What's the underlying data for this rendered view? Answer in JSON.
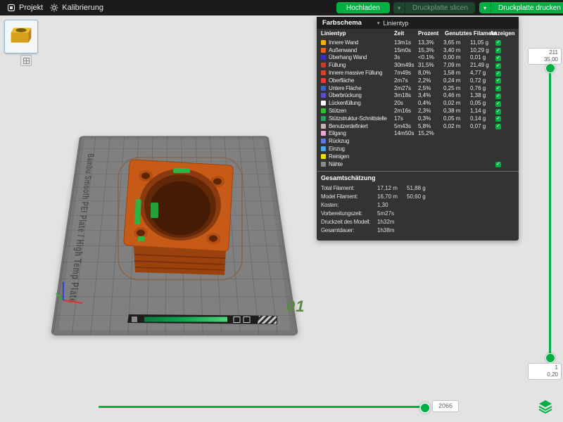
{
  "colors": {
    "accent": "#00AE42"
  },
  "topbar": {
    "project": "Projekt",
    "calibration": "Kalibrierung",
    "upload": "Hochladen",
    "slice": "Druckplatte slicen",
    "print": "Druckplatte drucken"
  },
  "viewport": {
    "plate_text": "Bambu Smooth PEI Plate / High Temp Plate",
    "plate_number": "01"
  },
  "panel": {
    "title": "Farbschema",
    "mode": "Linientyp",
    "columns": [
      "Linientyp",
      "Zeit",
      "Prozent",
      "Genutztes Filament",
      "Anzeigen"
    ],
    "rows": [
      {
        "name": "Innere Wand",
        "color": "#f8b500",
        "time": "13m1s",
        "percent": "13,3%",
        "filament_m": "3,65 m",
        "filament_g": "11,05 g",
        "checked": true
      },
      {
        "name": "Außenwand",
        "color": "#e8611c",
        "time": "15m0s",
        "percent": "15,3%",
        "filament_m": "3,40 m",
        "filament_g": "10,29 g",
        "checked": true
      },
      {
        "name": "Überhang Wand",
        "color": "#3a2cc8",
        "time": "3s",
        "percent": "<0.1%",
        "filament_m": "0,00 m",
        "filament_g": "0,01 g",
        "checked": true
      },
      {
        "name": "Füllung",
        "color": "#c23e28",
        "time": "30m49s",
        "percent": "31,5%",
        "filament_m": "7,09 m",
        "filament_g": "21,49 g",
        "checked": true
      },
      {
        "name": "Innere massive Füllung",
        "color": "#d8442a",
        "time": "7m49s",
        "percent": "8,0%",
        "filament_m": "1,58 m",
        "filament_g": "4,77 g",
        "checked": true
      },
      {
        "name": "Oberfläche",
        "color": "#ee3a3a",
        "time": "2m7s",
        "percent": "2,2%",
        "filament_m": "0,24 m",
        "filament_g": "0,72 g",
        "checked": true
      },
      {
        "name": "Untere Fläche",
        "color": "#3864c8",
        "time": "2m27s",
        "percent": "2,5%",
        "filament_m": "0,25 m",
        "filament_g": "0,76 g",
        "checked": true
      },
      {
        "name": "Überbrückung",
        "color": "#5a4fd0",
        "time": "3m18s",
        "percent": "3,4%",
        "filament_m": "0,46 m",
        "filament_g": "1,38 g",
        "checked": true
      },
      {
        "name": "Lückenfüllung",
        "color": "#ffffff",
        "time": "20s",
        "percent": "0,4%",
        "filament_m": "0,02 m",
        "filament_g": "0,05 g",
        "checked": true
      },
      {
        "name": "Stützen",
        "color": "#30c030",
        "time": "2m16s",
        "percent": "2,3%",
        "filament_m": "0,38 m",
        "filament_g": "1,14 g",
        "checked": true
      },
      {
        "name": "Stützstruktur-Schnittstelle",
        "color": "#2e9e5e",
        "time": "17s",
        "percent": "0,3%",
        "filament_m": "0,05 m",
        "filament_g": "0,14 g",
        "checked": true
      },
      {
        "name": "Benutzerdefiniert",
        "color": "#c8b4b4",
        "time": "5m43s",
        "percent": "5,8%",
        "filament_m": "0,02 m",
        "filament_g": "0,07 g",
        "checked": true
      },
      {
        "name": "Eilgang",
        "color": "#e6a6d8",
        "time": "14m50s",
        "percent": "15,2%",
        "filament_m": "",
        "filament_g": "",
        "checked": false
      },
      {
        "name": "Rückzug",
        "color": "#5a78e6",
        "time": "",
        "percent": "",
        "filament_m": "",
        "filament_g": "",
        "checked": false
      },
      {
        "name": "Einzug",
        "color": "#4aa8e8",
        "time": "",
        "percent": "",
        "filament_m": "",
        "filament_g": "",
        "checked": false
      },
      {
        "name": "Reinigen",
        "color": "#f0e000",
        "time": "",
        "percent": "",
        "filament_m": "",
        "filament_g": "",
        "checked": false
      },
      {
        "name": "Nähte",
        "color": "#8c8c8c",
        "time": "",
        "percent": "",
        "filament_m": "",
        "filament_g": "",
        "checked": true
      }
    ],
    "summary_title": "Gesamtschätzung",
    "summary": [
      {
        "label": "Total Filament:",
        "v1": "17,12 m",
        "v2": "51,88 g"
      },
      {
        "label": "Model Filament:",
        "v1": "16,70 m",
        "v2": "50,60 g"
      },
      {
        "label": "Kosten:",
        "v1": "1,30",
        "v2": ""
      },
      {
        "label": "Vorbereitungszeit:",
        "v1": "5m27s",
        "v2": ""
      },
      {
        "label": "Druckzeit des Modell:",
        "v1": "1h32m",
        "v2": ""
      },
      {
        "label": "Gesamtdauer:",
        "v1": "1h38m",
        "v2": ""
      }
    ]
  },
  "layer_slider": {
    "max_layer": "211",
    "max_height": "35,00",
    "min_layer": "1",
    "min_height": "0,20"
  },
  "step_slider": {
    "value": "2066"
  }
}
